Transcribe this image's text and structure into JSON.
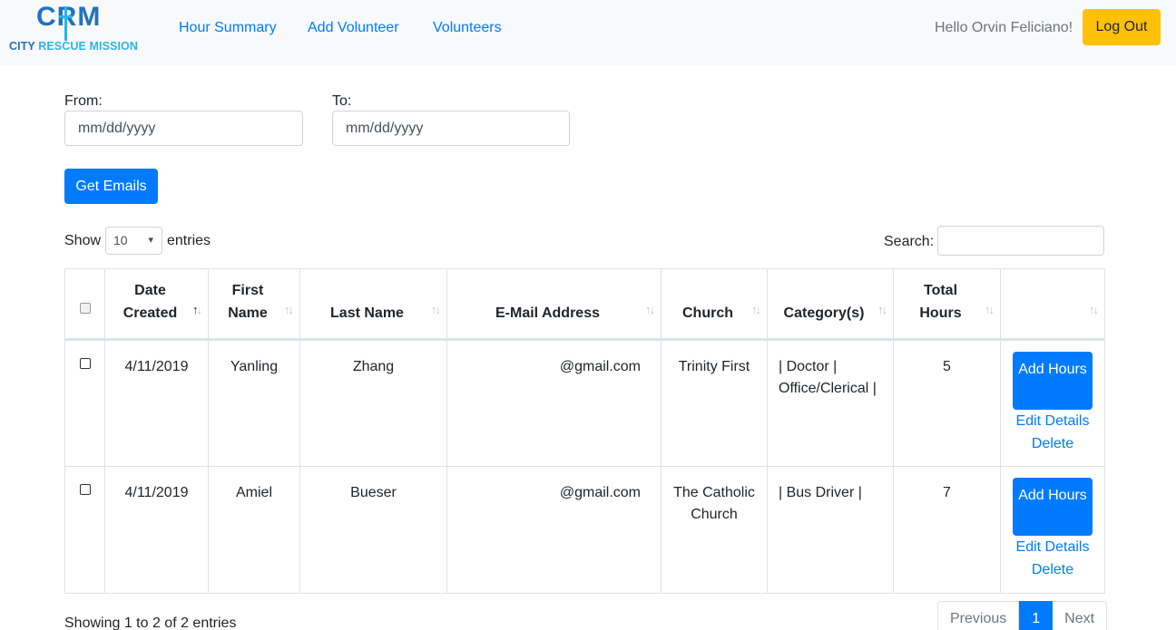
{
  "brand": {
    "mark": "CRM",
    "name_part1": "CITY ",
    "name_part2": "RESCUE MISSION"
  },
  "nav": {
    "links": [
      "Hour Summary",
      "Add Volunteer",
      "Volunteers"
    ],
    "greeting": "Hello Orvin Feliciano!",
    "logout_label": "Log Out"
  },
  "colors": {
    "primary": "#007bff",
    "warning": "#ffc107",
    "brand_blue": "#1e73be",
    "brand_cyan": "#29b6e8"
  },
  "filters": {
    "from_label": "From:",
    "from_placeholder": "mm/dd/yyyy",
    "to_label": "To:",
    "to_placeholder": "mm/dd/yyyy",
    "get_emails_label": "Get Emails"
  },
  "table_controls": {
    "show_label": "Show",
    "entries_value": "10",
    "entries_label": "entries",
    "search_label": "Search:",
    "search_value": ""
  },
  "table": {
    "headers": [
      {
        "line1": "Date",
        "line2": "Created"
      },
      {
        "line1": "First",
        "line2": "Name"
      },
      {
        "line1": "",
        "line2": "Last Name"
      },
      {
        "line1": "",
        "line2": "E-Mail Address"
      },
      {
        "line1": "",
        "line2": "Church"
      },
      {
        "line1": "",
        "line2": "Category(s)"
      },
      {
        "line1": "Total",
        "line2": "Hours"
      }
    ],
    "rows": [
      {
        "date": "4/11/2019",
        "first": "Yanling",
        "last": "Zhang",
        "email": "@gmail.com",
        "church": "Trinity First",
        "category": "| Doctor | Office/Clerical |",
        "hours": "5",
        "add_hours": "Add Hours",
        "edit": "Edit Details",
        "delete": "Delete"
      },
      {
        "date": "4/11/2019",
        "first": "Amiel",
        "last": "Bueser",
        "email": "@gmail.com",
        "church": "The Catholic Church",
        "category": "| Bus Driver |",
        "hours": "7",
        "add_hours": "Add Hours",
        "edit": "Edit Details",
        "delete": "Delete"
      }
    ]
  },
  "footer": {
    "info": "Showing 1 to 2 of 2 entries",
    "previous": "Previous",
    "current_page": "1",
    "next": "Next"
  }
}
